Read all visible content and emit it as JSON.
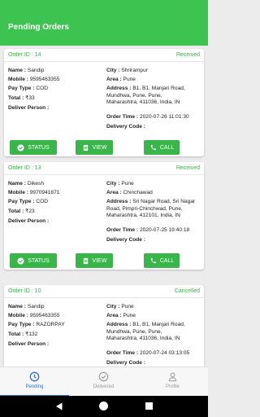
{
  "header": {
    "title": "Pending Orders"
  },
  "labels": {
    "name": "Name :",
    "mobile": "Mobile :",
    "pay_type": "Pay Type :",
    "total": "Total :",
    "deliver_person": "Deliver Person :",
    "city": "City :",
    "area": "Area :",
    "address": "Address :",
    "order_time": "Order Time :",
    "delivery_code": "Delivery Code :"
  },
  "buttons": {
    "status": "STATUS",
    "view": "VIEW",
    "call": "CALL"
  },
  "orders": [
    {
      "id": "Order ID : 14",
      "status": "Received",
      "status_color": "#3cb04a",
      "name": "Sandip",
      "mobile": "9595463355",
      "pay_type": "COD",
      "total": "₹33",
      "deliver_person": "",
      "city": "Shrirampur",
      "area": "Pune",
      "address_lines": [
        "B1, B1, Manjari Road,",
        "Mundhwa, Pune, Pune,",
        "Maharashtra, 411036, India, IN"
      ],
      "order_time": "2020-07-26 11:01:30",
      "delivery_code": ""
    },
    {
      "id": "Order ID : 13",
      "status": "Received",
      "status_color": "#3cb04a",
      "name": "Dikesh",
      "mobile": "9970941871",
      "pay_type": "COD",
      "total": "₹23",
      "deliver_person": "",
      "city": "Pune",
      "area": "Chinchawad",
      "address_lines": [
        "Sri Nagar Road, Sri Nagar",
        "Road, Pimpri-Chinchwad, Pune,",
        "Maharashtra, 412101, India, IN"
      ],
      "order_time": "2020-07-25 19:40:18",
      "delivery_code": ""
    },
    {
      "id": "Order ID : 10",
      "status": "Cancelled",
      "status_color": "#3cb04a",
      "name": "Sandip",
      "mobile": "9595463355",
      "pay_type": "RAZORPAY",
      "total": "₹132",
      "deliver_person": "",
      "city": "Pune",
      "area": "Pune",
      "address_lines": [
        "B1, B1, Manjari Road,",
        "Mundhwa, Pune, Pune,",
        "Maharashtra, 411036, India, IN"
      ],
      "order_time": "2020-07-24 03:13:05",
      "delivery_code": ""
    }
  ],
  "bottom_nav": {
    "items": [
      {
        "label": "Pending",
        "icon": "clock-icon",
        "active": true
      },
      {
        "label": "Delivered",
        "icon": "check-circle-icon",
        "active": false
      },
      {
        "label": "Profile",
        "icon": "person-icon",
        "active": false
      }
    ],
    "active_color": "#2f6fd6"
  },
  "colors": {
    "primary": "#3cc350",
    "button": "#39b54a"
  }
}
